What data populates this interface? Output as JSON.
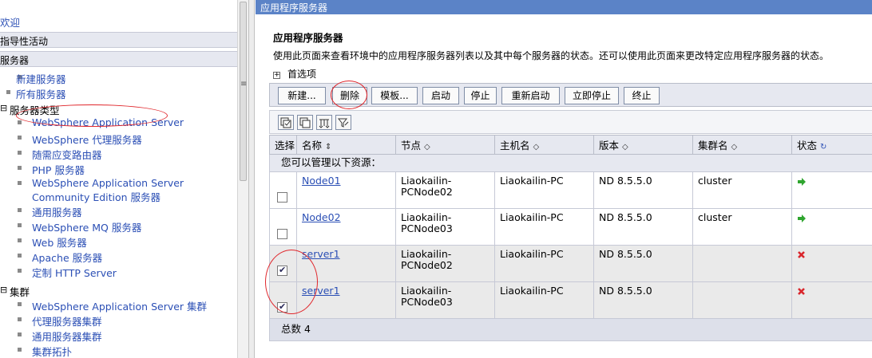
{
  "nav": {
    "welcome": "欢迎",
    "guided": "指导性活动",
    "servers_section": "服务器",
    "new_server": "新建服务器",
    "all_servers": "所有服务器",
    "server_types": "服务器类型",
    "server_type_items": [
      "WebSphere Application Server",
      "WebSphere 代理服务器",
      "随需应变路由器",
      "PHP 服务器",
      "WebSphere Application Server",
      "Community Edition 服务器",
      "通用服务器",
      "WebSphere MQ 服务器",
      "Web 服务器",
      "Apache 服务器",
      "定制 HTTP Server"
    ],
    "clusters": "集群",
    "cluster_items": [
      "WebSphere Application Server 集群",
      "代理服务器集群",
      "通用服务器集群",
      "集群拓扑"
    ],
    "expand_symbol": "⊟"
  },
  "main": {
    "window_title": "应用程序服务器",
    "page_title": "应用程序服务器",
    "description": "使用此页面来查看环境中的应用程序服务器列表以及其中每个服务器的状态。还可以使用此页面来更改特定应用程序服务器的状态。",
    "preferences": "首选项",
    "toolbar": {
      "new": "新建...",
      "delete": "删除",
      "template": "模板...",
      "start": "启动",
      "stop": "停止",
      "restart": "重新启动",
      "immediate_stop": "立即停止",
      "terminate": "终止"
    },
    "table": {
      "headers": [
        "选择",
        "名称",
        "节点",
        "主机名",
        "版本",
        "集群名",
        "状态"
      ],
      "info_row": "您可以管理以下资源：",
      "rows": [
        {
          "checked": false,
          "name": "Node01",
          "node": [
            "Liaokailin-",
            "PCNode02"
          ],
          "host": "Liaokailin-PC",
          "version": "ND 8.5.5.0",
          "cluster": "cluster",
          "status": "running"
        },
        {
          "checked": false,
          "name": "Node02",
          "node": [
            "Liaokailin-",
            "PCNode03"
          ],
          "host": "Liaokailin-PC",
          "version": "ND 8.5.5.0",
          "cluster": "cluster",
          "status": "running"
        },
        {
          "checked": true,
          "name": "server1",
          "node": [
            "Liaokailin-",
            "PCNode02"
          ],
          "host": "Liaokailin-PC",
          "version": "ND 8.5.5.0",
          "cluster": "",
          "status": "stopped"
        },
        {
          "checked": true,
          "name": "server1",
          "node": [
            "Liaokailin-",
            "PCNode03"
          ],
          "host": "Liaokailin-PC",
          "version": "ND 8.5.5.0",
          "cluster": "",
          "status": "stopped"
        }
      ],
      "total_label": "总数 4"
    }
  },
  "colors": {
    "title_bar": "#5b83c7",
    "link": "#2b4fb5",
    "annotation": "#e0262b",
    "running": "#2fa52f",
    "stopped": "#d9262c"
  }
}
